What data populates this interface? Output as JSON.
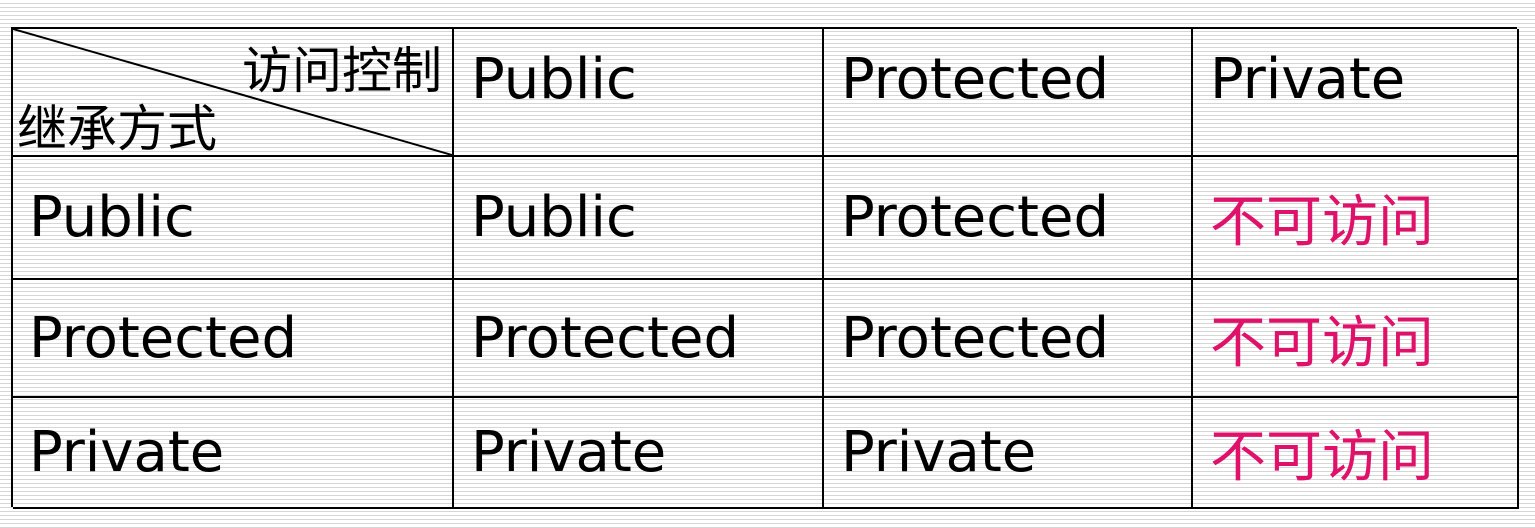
{
  "table": {
    "corner": {
      "top_label": "访问控制",
      "bottom_label": "继承方式"
    },
    "columns": [
      "Public",
      "Protected",
      "Private"
    ],
    "rows": [
      {
        "label": "Public",
        "cells": [
          "Public",
          "Protected",
          "不可访问"
        ]
      },
      {
        "label": "Protected",
        "cells": [
          "Protected",
          "Protected",
          "不可访问"
        ]
      },
      {
        "label": "Private",
        "cells": [
          "Private",
          "Private",
          "不可访问"
        ]
      }
    ],
    "colors": {
      "text": "#000000",
      "inaccessible": "#e0116b",
      "border": "#000000",
      "stripe": "#d6d6d6"
    }
  }
}
